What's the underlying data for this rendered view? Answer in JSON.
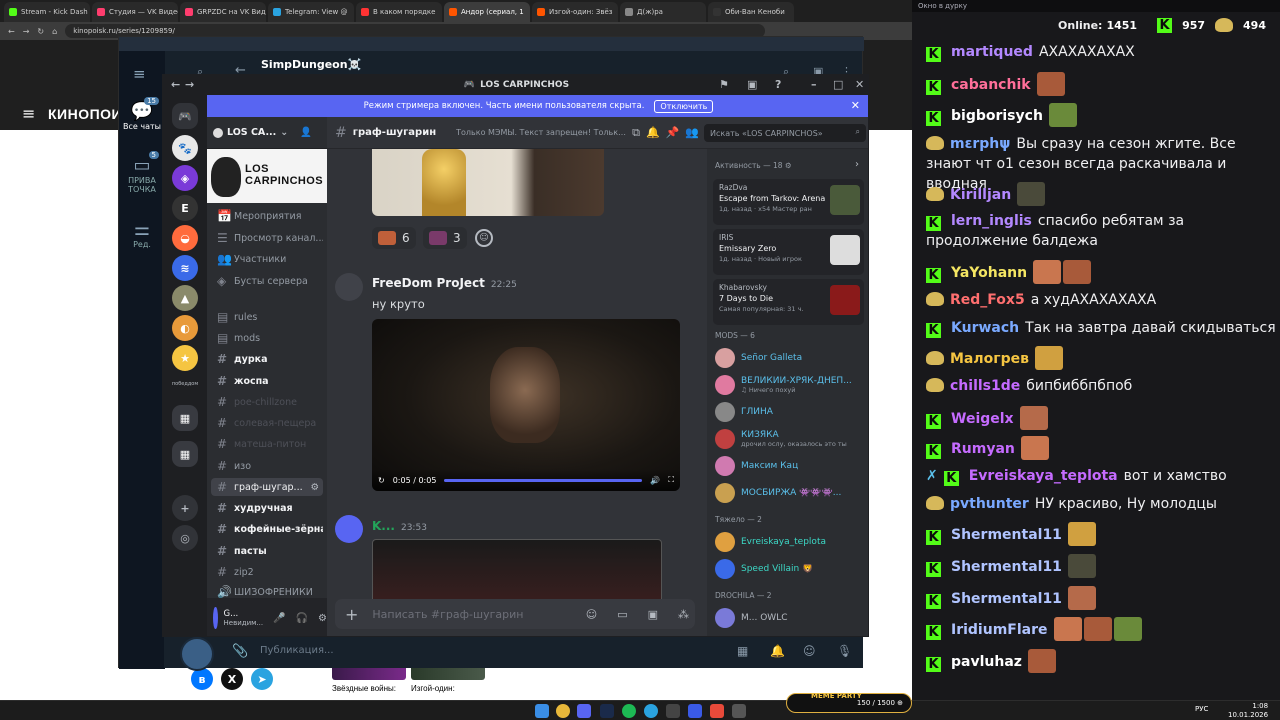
{
  "browser": {
    "tabs": [
      {
        "label": "Stream - Kick Dash",
        "color": "#53fc18"
      },
      {
        "label": "Студия — VK Видео",
        "color": "#ff3d6e"
      },
      {
        "label": "GRPZDC на VK Вид",
        "color": "#ff3d6e"
      },
      {
        "label": "Telegram: View @",
        "color": "#2aa3e0"
      },
      {
        "label": "В каком порядке",
        "color": "#ff3333"
      },
      {
        "label": "Андор (сериал, 1",
        "color": "#ff5500",
        "active": true
      },
      {
        "label": "Изгой-один: Звёз",
        "color": "#ff5500"
      },
      {
        "label": "Д(ж)ра",
        "color": "#888888"
      },
      {
        "label": "Оби-Ван Кеноби",
        "color": "#333333"
      }
    ],
    "url": "kinopoisk.ru/series/1209859/",
    "site_logo": "КИНОПОИС",
    "posters": [
      {
        "caption": "Звёздные войны:"
      },
      {
        "caption": "Изгой-один:"
      }
    ]
  },
  "telegram": {
    "chat_title": "SimpDungeon☠️",
    "folders": [
      {
        "label": "Все чаты",
        "badge": "15"
      },
      {
        "label": "ПРИВАТОЧКА",
        "badge": "5"
      },
      {
        "label": "Ред."
      }
    ],
    "composer_placeholder": "Публикация..."
  },
  "discord": {
    "window_title": "LOS CARPINCHOS",
    "streamer_banner": "Режим стримера включен. Часть имени пользователя скрыта.",
    "streamer_button": "Отключить",
    "server_name": "LOS CA...",
    "server_banner": [
      "LOS",
      "CARPINCHOS"
    ],
    "guild_label": "победдом",
    "channels": [
      {
        "name": "Мероприятия",
        "icon": "📅",
        "state": "normal"
      },
      {
        "name": "Просмотр канал...",
        "icon": "☰",
        "state": "normal"
      },
      {
        "name": "Участники",
        "icon": "👥",
        "state": "normal"
      },
      {
        "name": "Бусты сервера",
        "icon": "◈",
        "state": "normal"
      },
      {
        "name": "rules",
        "icon": "▤",
        "state": "normal"
      },
      {
        "name": "mods",
        "icon": "▤",
        "state": "normal"
      },
      {
        "name": "дурка",
        "icon": "#",
        "state": "unread"
      },
      {
        "name": "жоспа",
        "icon": "#",
        "state": "unread"
      },
      {
        "name": "poe-chillzone",
        "icon": "#",
        "state": "muted"
      },
      {
        "name": "солевая-пещера",
        "icon": "#",
        "state": "muted"
      },
      {
        "name": "матеша-питон",
        "icon": "#",
        "state": "muted"
      },
      {
        "name": "изо",
        "icon": "#",
        "state": "normal"
      },
      {
        "name": "граф-шугар...",
        "icon": "#",
        "state": "sel"
      },
      {
        "name": "худручная",
        "icon": "#",
        "state": "unread"
      },
      {
        "name": "кофейные-зёрна",
        "icon": "#",
        "state": "unread"
      },
      {
        "name": "пасты",
        "icon": "#",
        "state": "unread"
      },
      {
        "name": "zip2",
        "icon": "#",
        "state": "normal"
      },
      {
        "name": "ШИЗОФРЕНИКИ",
        "icon": "🔊",
        "state": "normal"
      }
    ],
    "user": {
      "name": "G...",
      "status": "Невидим..."
    },
    "channel": {
      "name": "граф-шугарин",
      "topic": "Только МЭМЫ. Текст запрещен! Только э...",
      "search_placeholder": "Искать «LOS CARPINCHOS»"
    },
    "reactions": [
      {
        "count": "6"
      },
      {
        "count": "3"
      }
    ],
    "messages": [
      {
        "author": "FreeDom ProJect",
        "time": "22:25",
        "text": "ну круто",
        "color": "#f2f3f5"
      },
      {
        "author": "K...",
        "time": "23:53",
        "text": "",
        "color": "#23a55a"
      }
    ],
    "video": {
      "time": "0:05 / 0:05",
      "progress": 1.0
    },
    "composer_placeholder": "Написать #граф-шугарин",
    "activity": {
      "header": "Активность — 18",
      "cards": [
        {
          "user": "RazDva",
          "game": "Escape from Tarkov: Arena",
          "time": "1д. назад · x54 Мастер ран",
          "color": "#4a5a3a"
        },
        {
          "user": "IRIS",
          "game": "Emissary Zero",
          "time": "1д. назад · Новый игрок",
          "color": "#dddddd"
        },
        {
          "user": "Khabarovsky",
          "game": "7 Days to Die",
          "time": "Самая популярная: 31 ч.",
          "color": "#8a1a1a"
        }
      ]
    },
    "groups": [
      {
        "name": "MODS — 6",
        "members": [
          {
            "name": "Señor Galleta",
            "color": "#5bc0eb",
            "sub": ""
          },
          {
            "name": "ВЕЛИКИЙ-ХРЯК-ДНЕП...",
            "color": "#5bc0eb",
            "sub": "♫ Ничего похуй"
          },
          {
            "name": "ГЛИНА",
            "color": "#5bc0eb",
            "sub": ""
          },
          {
            "name": "КИЗЯКА",
            "color": "#5bc0eb",
            "sub": "дрочил ослу, оказалось это ты"
          },
          {
            "name": "Максим Кац",
            "color": "#5bc0eb",
            "sub": ""
          },
          {
            "name": "МОСБИРЖА 👾👾👾...",
            "color": "#5bc0eb",
            "sub": ""
          }
        ]
      },
      {
        "name": "Тяжело — 2",
        "members": [
          {
            "name": "Evreiskaya_teplota",
            "color": "#3cd8c6",
            "sub": ""
          },
          {
            "name": "Speed Villain 🦁",
            "color": "#3cd8c6",
            "sub": ""
          }
        ]
      },
      {
        "name": "DROCHILA — 2",
        "members": [
          {
            "name": "M... OWLC",
            "color": "#b5bac1",
            "sub": ""
          }
        ]
      }
    ]
  },
  "chat": {
    "window_title": "Окно в дурку",
    "online_label": "Online:",
    "online_count": "1451",
    "kick_viewers": "957",
    "other_viewers": "494",
    "messages": [
      {
        "badge": "kick",
        "nick": "martiqued",
        "color": "#b388ff",
        "text": "АХАХАХАХАХ",
        "emotes": 0
      },
      {
        "badge": "kick",
        "nick": "cabanchik",
        "color": "#ff6f9a",
        "text": "",
        "emotes": 1
      },
      {
        "badge": "kick",
        "nick": "bigborisych",
        "color": "#ffffff",
        "text": "",
        "emotes": 1
      },
      {
        "badge": "tw",
        "nick": "mεrphψ",
        "color": "#7aa9ff",
        "text": "Вы сразу на сезон жгите. Все знают чт о1 сезон всегда раскачивала и вводная",
        "emotes": 0
      },
      {
        "badge": "tw",
        "nick": "Kirilljan",
        "color": "#b388ff",
        "text": "",
        "emotes": 1
      },
      {
        "badge": "kick",
        "nick": "lern_inglis",
        "color": "#b388ff",
        "text": "спасибо ребятам за продолжение балдежа",
        "emotes": 0
      },
      {
        "badge": "kick",
        "nick": "YaYohann",
        "color": "#f5e663",
        "text": "",
        "emotes": 2
      },
      {
        "badge": "tw",
        "nick": "Red_Fox5",
        "color": "#ff6f6f",
        "text": "а худАХАХАХАХА",
        "emotes": 0
      },
      {
        "badge": "kick",
        "nick": "Kurwach",
        "color": "#7aa9ff",
        "text": "Так на завтра давай скидываться",
        "emotes": 0
      },
      {
        "badge": "tw",
        "nick": "Малогрев",
        "color": "#f5c542",
        "text": "",
        "emotes": 1
      },
      {
        "badge": "tw",
        "nick": "chills1de",
        "color": "#c56bff",
        "text": "бипбиббпбпоб",
        "emotes": 0
      },
      {
        "badge": "kick",
        "nick": "Weigelx",
        "color": "#c56bff",
        "text": "",
        "emotes": 1
      },
      {
        "badge": "kick",
        "nick": "Rumyan",
        "color": "#c56bff",
        "text": "",
        "emotes": 1
      },
      {
        "badge": "kick2",
        "nick": "Evreiskaya_teplota",
        "color": "#c56bff",
        "text": "вот и хамство",
        "emotes": 0
      },
      {
        "badge": "tw",
        "nick": "pvthunter",
        "color": "#7aa9ff",
        "text": "НУ красиво, Ну молодцы",
        "emotes": 0
      },
      {
        "badge": "kick",
        "nick": "Shermental11",
        "color": "#b0c4ff",
        "text": "",
        "emotes": 1
      },
      {
        "badge": "kick",
        "nick": "Shermental11",
        "color": "#b0c4ff",
        "text": "",
        "emotes": 1
      },
      {
        "badge": "kick",
        "nick": "Shermental11",
        "color": "#b0c4ff",
        "text": "",
        "emotes": 1
      },
      {
        "badge": "kick",
        "nick": "IridiumFlare",
        "color": "#b0c4ff",
        "text": "",
        "emotes": 3
      },
      {
        "badge": "kick",
        "nick": "pavluhaz",
        "color": "#ffffff",
        "text": "",
        "emotes": 1
      }
    ]
  },
  "taskbar": {
    "lang": "РУС",
    "time": "1:08",
    "date": "10.01.2026",
    "meme_party": "MEME PARTY",
    "meme_count": "150 / 1500 ⊕"
  }
}
